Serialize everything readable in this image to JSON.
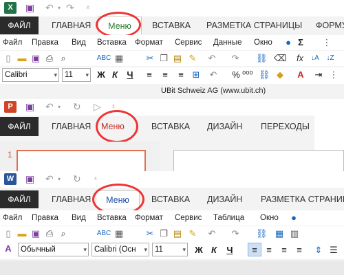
{
  "excel": {
    "app_icon_letter": "X",
    "app_icon_color": "#217346",
    "tabs": {
      "file": "ФАЙЛ",
      "home": "ГЛАВНАЯ",
      "menu": "Меню",
      "insert": "ВСТАВКА",
      "layout": "РАЗМЕТКА СТРАНИЦЫ",
      "formulas": "ФОРМУ"
    },
    "menus": [
      "Файл",
      "Правка",
      "Вид",
      "Вставка",
      "Формат",
      "Сервис",
      "Данные",
      "Окно"
    ],
    "font_name": "Calibri",
    "font_size": "11",
    "footer": "UBit Schweiz AG   (www.ubit.ch)"
  },
  "powerpoint": {
    "app_icon_letter": "P",
    "app_icon_color": "#d04525",
    "tabs": {
      "file": "ФАЙЛ",
      "home": "ГЛАВНАЯ",
      "menu": "Меню",
      "insert": "ВСТАВКА",
      "design": "ДИЗАЙН",
      "transitions": "ПЕРЕХОДЫ"
    },
    "slide_number": "1"
  },
  "word": {
    "app_icon_letter": "W",
    "app_icon_color": "#2b579a",
    "tabs": {
      "file": "ФАЙЛ",
      "home": "ГЛАВНАЯ",
      "menu": "Меню",
      "insert": "ВСТАВКА",
      "design": "ДИЗАЙН",
      "layout": "РАЗМЕТКА СТРАНИЦ"
    },
    "menus": [
      "Файл",
      "Правка",
      "Вид",
      "Вставка",
      "Формат",
      "Сервис",
      "Таблица",
      "Окно"
    ],
    "style_name": "Обычный",
    "font_name": "Calibri (Осн",
    "font_size": "11"
  },
  "shared": {
    "bold_label": "Ж",
    "italic_label": "К",
    "underline_label": "Ч",
    "highlight_color": "#e11111"
  }
}
